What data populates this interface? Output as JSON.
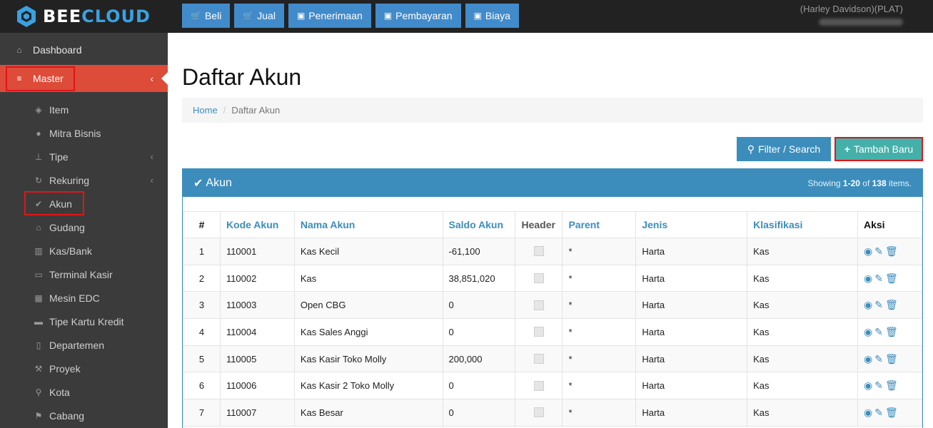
{
  "app": {
    "brand_a": "BEE",
    "brand_b": "CLOUD"
  },
  "topnav": [
    {
      "icon": "cart-icon",
      "label": "Beli"
    },
    {
      "icon": "cart-icon",
      "label": "Jual"
    },
    {
      "icon": "money-icon",
      "label": "Penerimaan"
    },
    {
      "icon": "money-icon",
      "label": "Pembayaran"
    },
    {
      "icon": "money-icon",
      "label": "Biaya"
    }
  ],
  "user": {
    "company": "(Harley Davidson)(PLAT)"
  },
  "sidebar": {
    "dashboard": "Dashboard",
    "master": "Master",
    "items": [
      {
        "label": "Item",
        "icon": "cube-icon"
      },
      {
        "label": "Mitra Bisnis",
        "icon": "users-icon"
      },
      {
        "label": "Tipe",
        "icon": "sitemap-icon",
        "expandable": true
      },
      {
        "label": "Rekuring",
        "icon": "refresh-icon",
        "expandable": true
      },
      {
        "label": "Akun",
        "icon": "check-icon"
      },
      {
        "label": "Gudang",
        "icon": "home-icon"
      },
      {
        "label": "Kas/Bank",
        "icon": "bank-icon"
      },
      {
        "label": "Terminal Kasir",
        "icon": "desktop-icon"
      },
      {
        "label": "Mesin EDC",
        "icon": "calculator-icon"
      },
      {
        "label": "Tipe Kartu Kredit",
        "icon": "credit-card-icon"
      },
      {
        "label": "Departemen",
        "icon": "clipboard-icon"
      },
      {
        "label": "Proyek",
        "icon": "gavel-icon"
      },
      {
        "label": "Kota",
        "icon": "map-marker-icon"
      },
      {
        "label": "Cabang",
        "icon": "flag-icon"
      }
    ]
  },
  "page": {
    "title": "Daftar Akun",
    "breadcrumb_home": "Home",
    "breadcrumb_current": "Daftar Akun",
    "filter_label": "Filter / Search",
    "add_label": "Tambah Baru",
    "panel_title": "Akun",
    "summary_prefix": "Showing ",
    "summary_range": "1-20",
    "summary_of": " of ",
    "summary_total": "138",
    "summary_suffix": " items."
  },
  "table": {
    "headers": [
      "#",
      "Kode Akun",
      "Nama Akun",
      "Saldo Akun",
      "Header",
      "Parent",
      "Jenis",
      "Klasifikasi",
      "Aksi"
    ],
    "rows": [
      {
        "no": "1",
        "kode": "110001",
        "nama": "Kas Kecil",
        "saldo": "-61,100",
        "parent": "*",
        "jenis": "Harta",
        "klasifikasi": "Kas"
      },
      {
        "no": "2",
        "kode": "110002",
        "nama": "Kas",
        "saldo": "38,851,020",
        "parent": "*",
        "jenis": "Harta",
        "klasifikasi": "Kas"
      },
      {
        "no": "3",
        "kode": "110003",
        "nama": "Open CBG",
        "saldo": "0",
        "parent": "*",
        "jenis": "Harta",
        "klasifikasi": "Kas"
      },
      {
        "no": "4",
        "kode": "110004",
        "nama": "Kas Sales Anggi",
        "saldo": "0",
        "parent": "*",
        "jenis": "Harta",
        "klasifikasi": "Kas"
      },
      {
        "no": "5",
        "kode": "110005",
        "nama": "Kas Kasir Toko Molly",
        "saldo": "200,000",
        "parent": "*",
        "jenis": "Harta",
        "klasifikasi": "Kas"
      },
      {
        "no": "6",
        "kode": "110006",
        "nama": "Kas Kasir 2 Toko Molly",
        "saldo": "0",
        "parent": "*",
        "jenis": "Harta",
        "klasifikasi": "Kas"
      },
      {
        "no": "7",
        "kode": "110007",
        "nama": "Kas Besar",
        "saldo": "0",
        "parent": "*",
        "jenis": "Harta",
        "klasifikasi": "Kas"
      }
    ]
  }
}
